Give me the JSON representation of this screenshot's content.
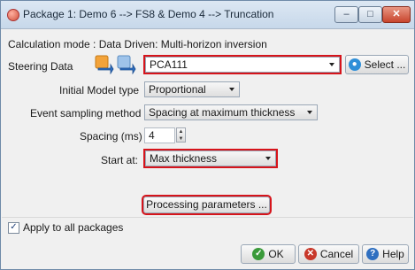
{
  "window": {
    "title": "Package 1: Demo 6 --> FS8 & Demo 4 --> Truncation",
    "minimize": "–",
    "maximize": "□",
    "close": "✕"
  },
  "mode_text": "Calculation mode : Data Driven: Multi-horizon inversion",
  "steering": {
    "label": "Steering Data",
    "value": "PCA111",
    "select_label": "Select ..."
  },
  "initial_model": {
    "label": "Initial Model type",
    "value": "Proportional"
  },
  "event_sampling": {
    "label": "Event sampling method",
    "value": "Spacing at maximum thickness"
  },
  "spacing": {
    "label": "Spacing (ms)",
    "value": "4"
  },
  "start_at": {
    "label": "Start at:",
    "value": "Max thickness"
  },
  "processing_button": "Processing parameters ...",
  "apply_all": {
    "label": "Apply to all packages",
    "checked": true
  },
  "footer": {
    "ok": "OK",
    "cancel": "Cancel",
    "help": "Help"
  },
  "colors": {
    "highlight": "#d6141b",
    "accent_blue": "#2f6fc0",
    "ok_green": "#3a9a3a",
    "cancel_red": "#c8382a"
  }
}
